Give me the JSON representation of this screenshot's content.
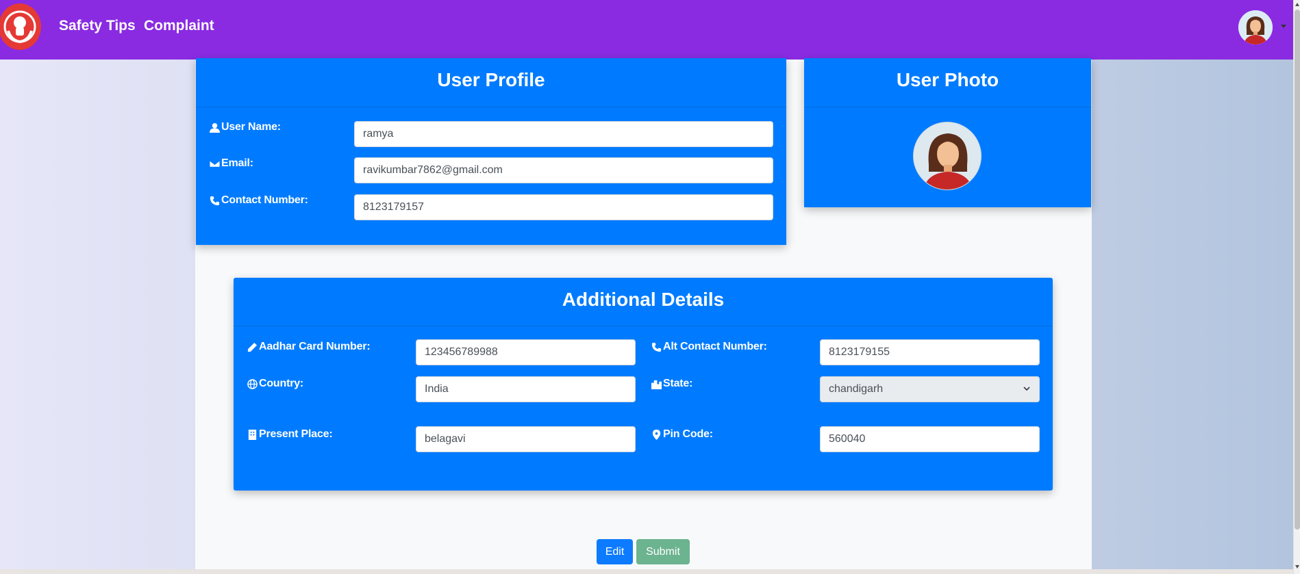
{
  "nav": {
    "links": [
      "Safety Tips",
      "Complaint"
    ]
  },
  "profile": {
    "title": "User Profile",
    "fields": [
      {
        "label": "User Name:",
        "value": "ramya",
        "icon": "user-icon"
      },
      {
        "label": "Email:",
        "value": "ravikumbar7862@gmail.com",
        "icon": "envelope-icon"
      },
      {
        "label": "Contact Number:",
        "value": "8123179157",
        "icon": "phone-icon"
      }
    ]
  },
  "photo": {
    "title": "User Photo"
  },
  "details": {
    "title": "Additional Details",
    "aadhar": {
      "label": "Aadhar Card Number:",
      "value": "123456789988",
      "icon": "pencil-icon"
    },
    "alt_contact": {
      "label": "Alt Contact Number:",
      "value": "8123179155",
      "icon": "phone-icon"
    },
    "country": {
      "label": "Country:",
      "value": "India",
      "icon": "globe-icon"
    },
    "state": {
      "label": "State:",
      "value": "chandigarh",
      "icon": "city-icon"
    },
    "present_place": {
      "label": "Present Place:",
      "value": "belagavi",
      "icon": "building-icon"
    },
    "pin_code": {
      "label": "Pin Code:",
      "value": "560040",
      "icon": "map-pin-icon"
    }
  },
  "buttons": {
    "edit": "Edit",
    "submit": "Submit"
  },
  "colors": {
    "navbar": "#8a2be2",
    "card": "#007bff",
    "submit": "#6cb38f"
  }
}
